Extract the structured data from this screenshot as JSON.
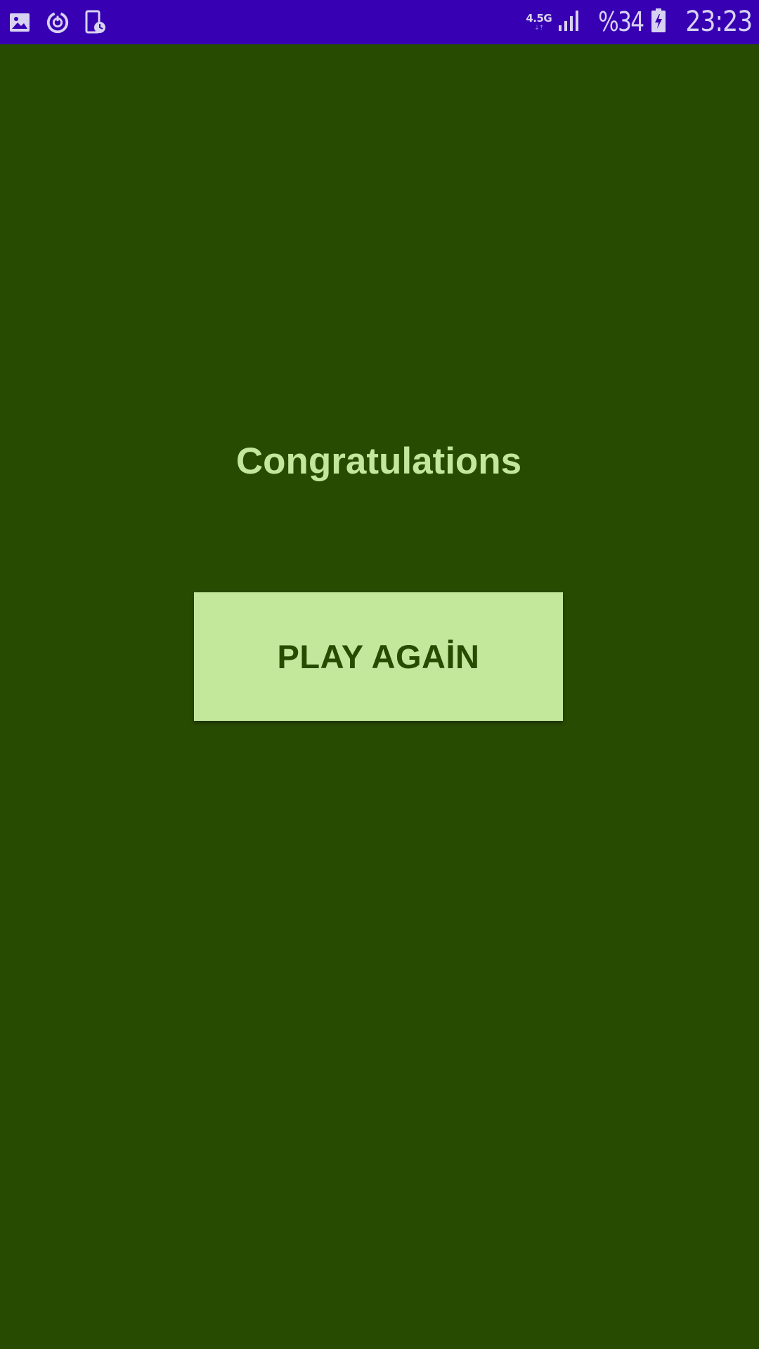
{
  "status_bar": {
    "background": "#3700b3",
    "left_icons": [
      "gallery-icon",
      "data-saver-icon",
      "device-timer-icon"
    ],
    "network_label": "4.5G",
    "network_arrows": "⇣⇡",
    "signal_icon": "signal-bars-icon",
    "battery_percent": "%34",
    "battery_icon": "battery-charging-icon",
    "time": "23:23"
  },
  "screen": {
    "background": "#284b02",
    "title": "Congratulations",
    "play_again_label": "PLAY AGAİN",
    "accent": "#c3e79b"
  }
}
